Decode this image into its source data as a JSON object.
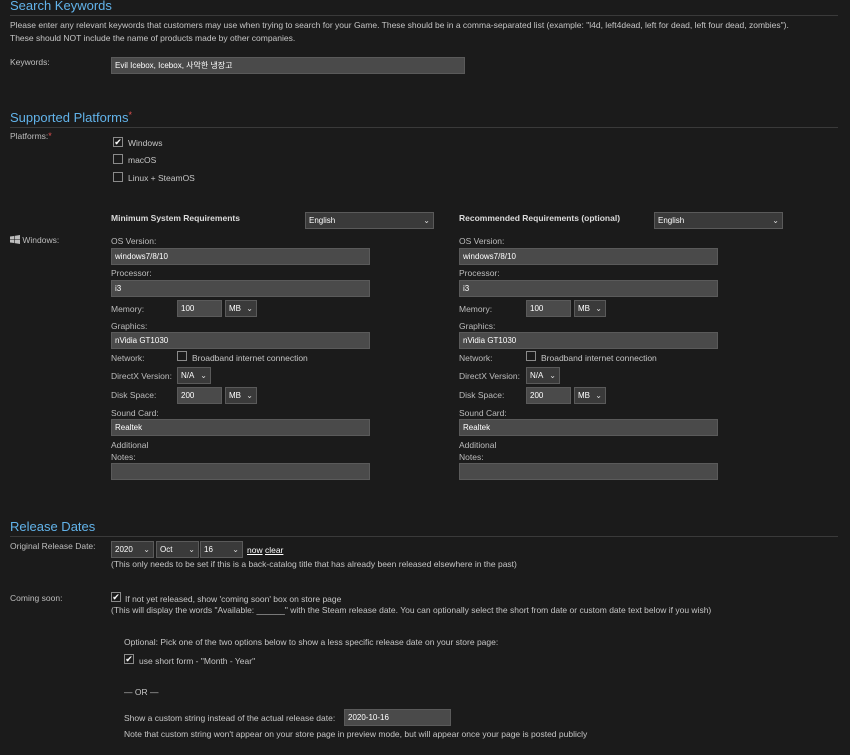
{
  "keywords_section": {
    "title": "Search Keywords",
    "description_line1": "Please enter any relevant keywords that customers may use when trying to search for your Game. These should be in a comma-separated list (example: \"l4d, left4dead, left for dead, left four dead, zombies\").",
    "description_line2": "These should NOT include the name of products made by other companies.",
    "label": "Keywords:",
    "value": "Evil Icebox, Icebox, 사악한 냉장고"
  },
  "platforms_section": {
    "title": "Supported Platforms",
    "required_mark": "*",
    "label": "Platforms:",
    "options": [
      {
        "label": "Windows",
        "checked": true
      },
      {
        "label": "macOS",
        "checked": false
      },
      {
        "label": "Linux + SteamOS",
        "checked": false
      }
    ]
  },
  "requirements": {
    "os_label": "Windows:",
    "min": {
      "heading": "Minimum System Requirements",
      "language": "English",
      "os_version_label": "OS Version:",
      "os_version": "windows7/8/10",
      "processor_label": "Processor:",
      "processor": "i3",
      "memory_label": "Memory:",
      "memory": "100",
      "memory_unit": "MB",
      "graphics_label": "Graphics:",
      "graphics": "nVidia GT1030",
      "network_label": "Network:",
      "network_option": "Broadband internet connection",
      "directx_label": "DirectX Version:",
      "directx": "N/A",
      "disk_label": "Disk Space:",
      "disk": "200",
      "disk_unit": "MB",
      "sound_label": "Sound Card:",
      "sound": "Realtek",
      "notes_label_1": "Additional",
      "notes_label_2": "Notes:",
      "notes": ""
    },
    "rec": {
      "heading": "Recommended Requirements (optional)",
      "language": "English",
      "os_version_label": "OS Version:",
      "os_version": "windows7/8/10",
      "processor_label": "Processor:",
      "processor": "i3",
      "memory_label": "Memory:",
      "memory": "100",
      "memory_unit": "MB",
      "graphics_label": "Graphics:",
      "graphics": "nVidia GT1030",
      "network_label": "Network:",
      "network_option": "Broadband internet connection",
      "directx_label": "DirectX Version:",
      "directx": "N/A",
      "disk_label": "Disk Space:",
      "disk": "200",
      "disk_unit": "MB",
      "sound_label": "Sound Card:",
      "sound": "Realtek",
      "notes_label_1": "Additional",
      "notes_label_2": "Notes:",
      "notes": ""
    }
  },
  "release_section": {
    "title": "Release Dates",
    "original_label": "Original Release Date:",
    "year": "2020",
    "month": "Oct",
    "day": "16",
    "now_link": "now",
    "clear_link": "clear",
    "original_note": "(This only needs to be set if this is a back-catalog title that has already been released elsewhere in the past)",
    "coming_soon_label": "Coming soon:",
    "coming_soon_option": "If not yet released, show 'coming soon' box on store page",
    "coming_soon_note": "(This will display the words \"Available: ______\" with the Steam release date. You can optionally select the short from date or custom date text below if you wish)",
    "optional_text": "Optional: Pick one of the two options below to show a less specific release date on your store page:",
    "short_form_option": "use short form - \"Month - Year\"",
    "or_text": "— OR —",
    "custom_label": "Show a custom string instead of the actual release date:",
    "custom_value": "2020-10-16",
    "custom_note": "Note that custom string won't appear on your store page in preview mode, but will appear once your page is posted publicly"
  }
}
